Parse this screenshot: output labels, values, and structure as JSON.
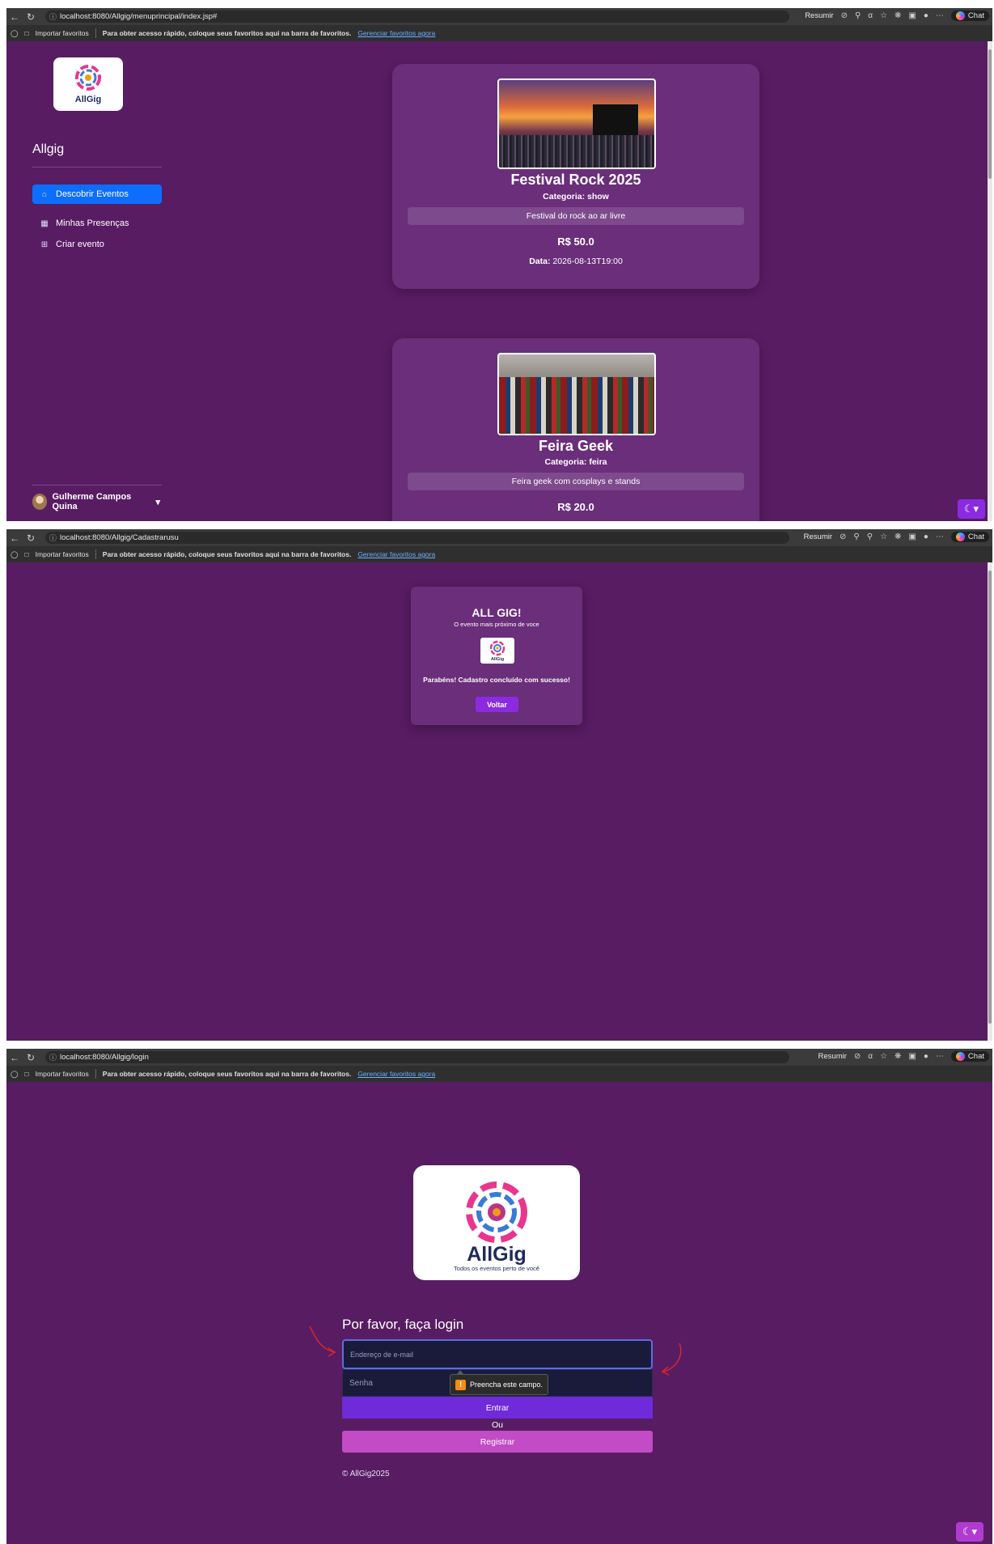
{
  "colors": {
    "page_bg": "#581c63",
    "card_bg": "#6b2e7a",
    "active_nav": "#0d6efd",
    "primary_button": "#8a2be2",
    "entrar_button": "#6f2ad9",
    "registrar_button": "#c24bc6",
    "annotation_arrow": "#d9262a"
  },
  "browser": {
    "summary_label": "Resumir",
    "chat_label": "Chat",
    "favorites": {
      "import_label": "Importar favoritos",
      "message": "Para obter acesso rápido, coloque seus favoritos aqui na barra de favoritos.",
      "manage_link": "Gerenciar favoritos agora"
    }
  },
  "screen1": {
    "url": "localhost:8080/Allgig/menuprincipal/index.jsp#",
    "logo_text": "AllGig",
    "brand": "Allgig",
    "nav": [
      {
        "label": "Descobrir Eventos",
        "icon": "home-icon",
        "active": true
      },
      {
        "label": "Minhas Presenças",
        "icon": "table-icon",
        "active": false
      },
      {
        "label": "Criar evento",
        "icon": "grid-icon",
        "active": false
      }
    ],
    "user_name": "Gulherme Campos Quina",
    "theme_icon": "moon-icon",
    "events": [
      {
        "title": "Festival Rock 2025",
        "category": "Categoria: show",
        "description": "Festival do rock ao ar livre",
        "price": "R$ 50.0",
        "date_label": "Data:",
        "date_value": "2026-08-13T19:00"
      },
      {
        "title": "Feira Geek",
        "category": "Categoria: feira",
        "description": "Feira geek com cosplays e stands",
        "price": "R$ 20.0"
      }
    ]
  },
  "screen2": {
    "url": "localhost:8080/Allgig/Cadastrarusu",
    "title": "ALL GIG!",
    "subtitle": "O evento mais próximo de voce",
    "logo_text": "AllGig",
    "message": "Parabéns! Cadastro concluído com sucesso!",
    "button": "Voltar"
  },
  "screen3": {
    "url": "localhost:8080/Allgig/login",
    "logo_text": "AllGig",
    "logo_tagline": "Todos os eventos perto de você",
    "heading": "Por favor, faça login",
    "email_placeholder": "Endereço de e-mail",
    "password_placeholder": "Senha",
    "tooltip": "Preencha este campo.",
    "login_button": "Entrar",
    "or_text": "Ou",
    "register_button": "Registrar",
    "copyright": "© AllGig2025",
    "theme_icon": "moon-icon"
  }
}
